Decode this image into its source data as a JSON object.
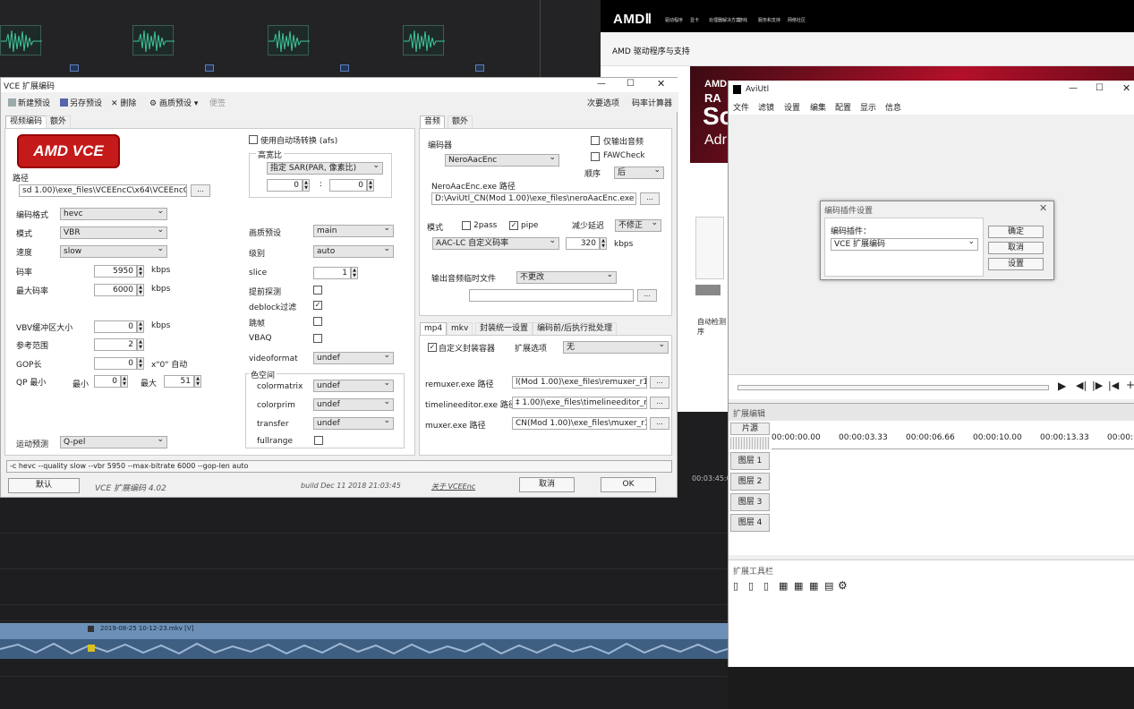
{
  "amd": {
    "logo": "AMDⅡ",
    "nav": [
      "驱动程序",
      "显卡",
      "处理器解决方案",
      "游戏",
      "服务和支持",
      "网络社区"
    ],
    "subtitle": "AMD 驱动程序与支持",
    "hero_line1": "AMD",
    "hero_line2": "RA",
    "hero_line3": "So",
    "hero_line4": "Adr",
    "side1": "自动检测",
    "side2": "序"
  },
  "aviutl": {
    "title": "AviUtl",
    "menu": [
      "文件",
      "滤镜",
      "设置",
      "编集",
      "配置",
      "显示",
      "信息"
    ],
    "ext_title": "扩展编辑",
    "clip_header": "片源",
    "timecodes": [
      "00:00:00.00",
      "00:00:03.33",
      "00:00:06.66",
      "00:00:10.00",
      "00:00:13.33",
      "00:00:1"
    ],
    "layers": [
      "图层 1",
      "图层 2",
      "图层 3",
      "图层 4"
    ],
    "toolbar_title": "扩展工具栏"
  },
  "dialog": {
    "title": "编码插件设置",
    "plugin_label": "编码插件：",
    "plugin_value": "VCE 扩展编码",
    "ok": "确定",
    "cancel": "取消",
    "settings": "设置"
  },
  "editor": {
    "clip_name": "2019-08-25 10-12-23.mkv [V]",
    "timecode": "00:03:45:0"
  },
  "vce": {
    "title": "VCE 扩展编码",
    "toolbar": {
      "new_preset": "新建预设",
      "save_as": "另存预设",
      "delete": "删除",
      "quality_preset": "画质预设",
      "convenient": "便签",
      "next_options": "次要选项",
      "bitrate_calc": "码率计算器"
    },
    "tabs_left": [
      "视频编码",
      "额外"
    ],
    "logo_text": "AMD VCE",
    "path_label": "路径",
    "path_value": "sd 1.00)\\exe_files\\VCEEncC\\x64\\VCEEncC64.exe",
    "fields": {
      "codec_label": "编码格式",
      "codec_value": "hevc",
      "mode_label": "模式",
      "mode_value": "VBR",
      "speed_label": "速度",
      "speed_value": "slow",
      "bitrate_label": "码率",
      "bitrate_value": "5950",
      "maxrate_label": "最大码率",
      "maxrate_value": "6000",
      "kbps": "kbps",
      "vbv_label": "VBV缓冲区大小",
      "vbv_value": "0",
      "ref_label": "参考范围",
      "ref_value": "2",
      "gop_label": "GOP长",
      "gop_value": "0",
      "gop_auto": "\"0\" 自动",
      "qp_label": "QP 最小",
      "qp_min_label": "最小",
      "qp_min_value": "0",
      "qp_max_label": "最大",
      "qp_max_value": "51",
      "motion_label": "运动预测",
      "motion_value": "Q-pel"
    },
    "mid": {
      "afs_label": "使用自动场转换 (afs)",
      "aspect_label": "高宽比",
      "aspect_value": "指定 SAR(PAR, 像素比)",
      "sar_x": "0",
      "sar_sep": ":",
      "sar_y": "0",
      "profile_label": "画质预设",
      "profile_value": "main",
      "level_label": "级别",
      "level_value": "auto",
      "slice_label": "slice",
      "slice_value": "1",
      "prepass_label": "提前探测",
      "deblock_label": "deblock过滤",
      "skip_label": "跳帧",
      "vbaq_label": "VBAQ",
      "videoformat_label": "videoformat",
      "videoformat_value": "undef",
      "colorspace_label": "色空间",
      "colormatrix_label": "colormatrix",
      "colormatrix_value": "undef",
      "colorprim_label": "colorprim",
      "colorprim_value": "undef",
      "transfer_label": "transfer",
      "transfer_value": "undef",
      "fullrange_label": "fullrange"
    },
    "audio": {
      "tabs": [
        "音频",
        "额外"
      ],
      "encoder_label": "编码器",
      "encoder_value": "NeroAacEnc",
      "only_audio": "仅输出音频",
      "fawcheck": "FAWCheck",
      "order_label": "顺序",
      "order_value": "后",
      "path_label": "NeroAacEnc.exe 路径",
      "path_value": "D:\\AviUtl_CN(Mod 1.00)\\exe_files\\neroAacEnc.exe",
      "mode_label": "模式",
      "twopass": "2pass",
      "pipe": "pipe",
      "delay_label": "减少延迟",
      "delay_value": "不修正",
      "profile_value": "AAC-LC 自定义码率",
      "bitrate_value": "320",
      "kbps": "kbps",
      "temp_label": "输出音频临时文件",
      "temp_value": "不更改"
    },
    "mux": {
      "tabs": [
        "mp4",
        "mkv",
        "封装统一设置",
        "编码前/后执行批处理"
      ],
      "custom_label": "自定义封装容器",
      "ext_label": "扩展选项",
      "ext_value": "无",
      "remuxer_label": "remuxer.exe 路径",
      "remuxer_value": "l(Mod 1.00)\\exe_files\\remuxer_r1474.exe",
      "timeline_label": "timelineeditor.exe 路径",
      "timeline_value": "‡ 1.00)\\exe_files\\timelineeditor_r1474.exe",
      "muxer_label": "muxer.exe 路径",
      "muxer_value": "CN(Mod 1.00)\\exe_files\\muxer_r1474.exe"
    },
    "cmdline": "-c hevc --quality slow --vbr 5950 --max-bitrate 6000 --gop-len auto",
    "bottom": {
      "default": "默认",
      "name": "VCE 扩展编码 4.02",
      "build": "build Dec 11 2018 21:03:45",
      "about": "关于 VCEEnc",
      "cancel": "取消",
      "ok": "OK"
    }
  }
}
